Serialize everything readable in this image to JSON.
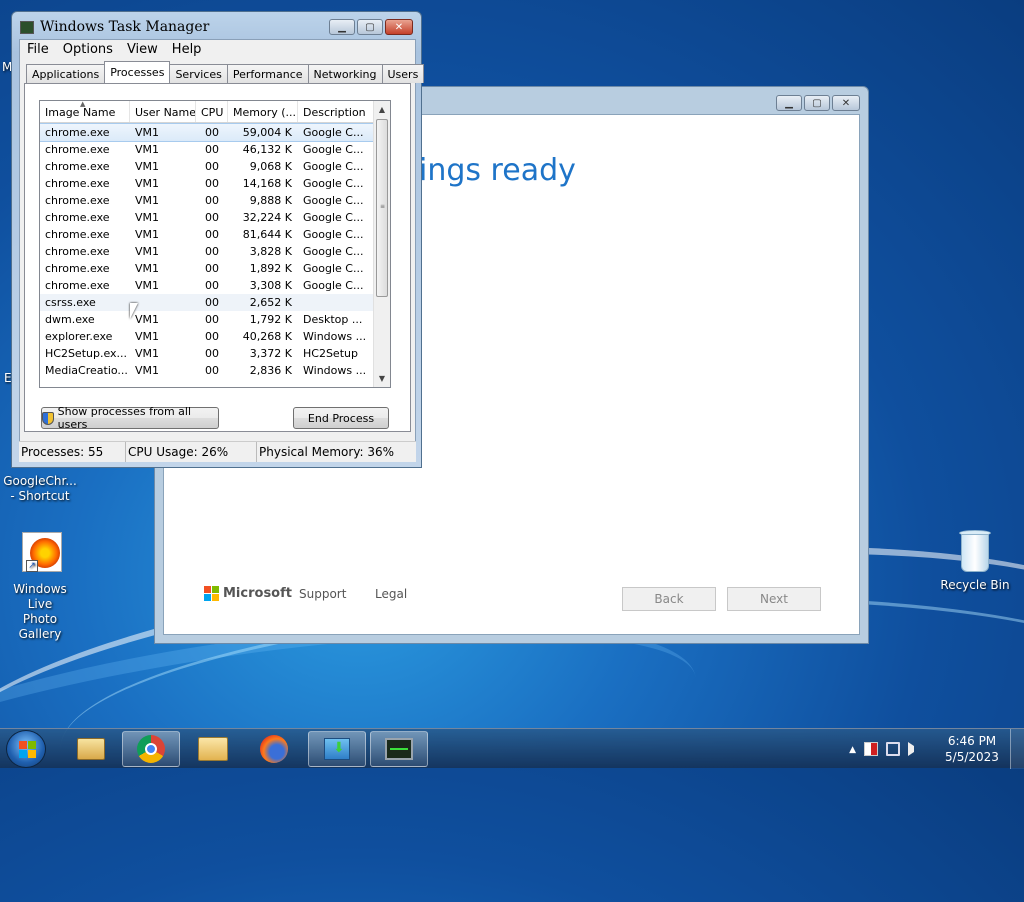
{
  "desktop": {
    "icons": [
      {
        "label_line1": "GoogleChr...",
        "label_line2": "- Shortcut"
      },
      {
        "label_line1": "Windows Live",
        "label_line2": "Photo Gallery"
      },
      {
        "label_line1": "Recycle Bin",
        "label_line2": ""
      }
    ],
    "edge_letters": [
      "M",
      "E"
    ]
  },
  "setup_window": {
    "heading": "ings ready",
    "brand": "Microsoft",
    "links": [
      "Support",
      "Legal"
    ],
    "buttons": {
      "back": "Back",
      "next": "Next"
    }
  },
  "task_manager": {
    "title": "Windows Task Manager",
    "menu": [
      "File",
      "Options",
      "View",
      "Help"
    ],
    "tabs": [
      "Applications",
      "Processes",
      "Services",
      "Performance",
      "Networking",
      "Users"
    ],
    "active_tab": "Processes",
    "columns": [
      "Image Name",
      "User Name",
      "CPU",
      "Memory (...",
      "Description"
    ],
    "rows": [
      [
        "chrome.exe",
        "VM1",
        "00",
        "59,004 K",
        "Google C..."
      ],
      [
        "chrome.exe",
        "VM1",
        "00",
        "46,132 K",
        "Google C..."
      ],
      [
        "chrome.exe",
        "VM1",
        "00",
        "9,068 K",
        "Google C..."
      ],
      [
        "chrome.exe",
        "VM1",
        "00",
        "14,168 K",
        "Google C..."
      ],
      [
        "chrome.exe",
        "VM1",
        "00",
        "9,888 K",
        "Google C..."
      ],
      [
        "chrome.exe",
        "VM1",
        "00",
        "32,224 K",
        "Google C..."
      ],
      [
        "chrome.exe",
        "VM1",
        "00",
        "81,644 K",
        "Google C..."
      ],
      [
        "chrome.exe",
        "VM1",
        "00",
        "3,828 K",
        "Google C..."
      ],
      [
        "chrome.exe",
        "VM1",
        "00",
        "1,892 K",
        "Google C..."
      ],
      [
        "chrome.exe",
        "VM1",
        "00",
        "3,308 K",
        "Google C..."
      ],
      [
        "csrss.exe",
        "",
        "00",
        "2,652 K",
        ""
      ],
      [
        "dwm.exe",
        "VM1",
        "00",
        "1,792 K",
        "Desktop ..."
      ],
      [
        "explorer.exe",
        "VM1",
        "00",
        "40,268 K",
        "Windows ..."
      ],
      [
        "HC2Setup.ex...",
        "VM1",
        "00",
        "3,372 K",
        "HC2Setup"
      ],
      [
        "MediaCreatio...",
        "VM1",
        "00",
        "2,836 K",
        "Windows ..."
      ]
    ],
    "show_all_label": "Show processes from all users",
    "end_process_label": "End Process",
    "status": {
      "processes": "Processes: 55",
      "cpu": "CPU Usage: 26%",
      "memory": "Physical Memory: 36%"
    }
  },
  "taskbar": {
    "clock_time": "6:46 PM",
    "clock_date": "5/5/2023",
    "tray_up_arrow": "▲"
  }
}
